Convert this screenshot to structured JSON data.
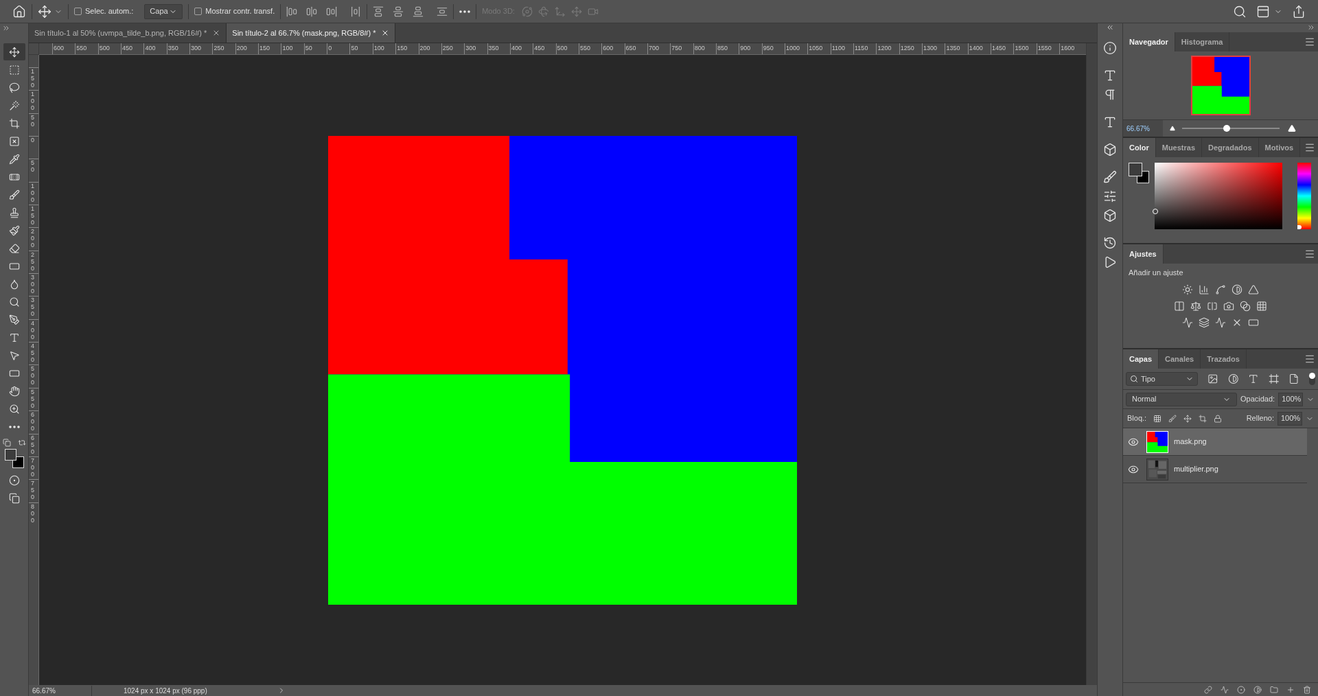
{
  "options_bar": {
    "auto_select": {
      "label": "Selec. autom.:",
      "checked": false
    },
    "target": "Capa",
    "show_transform": {
      "label": "Mostrar contr. transf.",
      "checked": false
    },
    "mode_3d": {
      "label": "Modo 3D:",
      "disabled": true
    }
  },
  "document_tabs": [
    {
      "title": "Sin título-1 al 50% (uvmpa_tilde_b.png, RGB/16#) *",
      "selected": false
    },
    {
      "title": "Sin título-2 al 66.7% (mask.png, RGB/8#) *",
      "selected": true
    }
  ],
  "tools": [
    {
      "selected": true
    },
    {
      "selected": false
    },
    {
      "selected": false
    },
    {
      "selected": false
    },
    {
      "selected": false
    },
    {
      "selected": false
    },
    {
      "selected": false
    },
    {
      "selected": false
    },
    {
      "selected": false
    },
    {
      "selected": false
    },
    {
      "selected": false
    },
    {
      "selected": false
    },
    {
      "selected": false
    },
    {
      "selected": false
    },
    {
      "selected": false
    },
    {
      "selected": false
    },
    {
      "selected": false
    },
    {
      "selected": false
    },
    {
      "selected": false
    },
    {
      "selected": false
    },
    {
      "selected": false
    },
    {
      "selected": false
    }
  ],
  "ruler_h": [
    "600",
    "550",
    "500",
    "450",
    "400",
    "350",
    "300",
    "250",
    "200",
    "150",
    "100",
    "50",
    "0",
    "50",
    "100",
    "150",
    "200",
    "250",
    "300",
    "350",
    "400",
    "450",
    "500",
    "550",
    "600",
    "650",
    "700",
    "750",
    "800",
    "850",
    "900",
    "950",
    "1000",
    "1050",
    "1100",
    "1150",
    "1200",
    "1250",
    "1300",
    "1350",
    "1400",
    "1450",
    "1500",
    "1550",
    "1600"
  ],
  "ruler_v": [
    "150",
    "100",
    "50",
    "0",
    "50",
    "100",
    "150",
    "200",
    "250",
    "300",
    "350",
    "400",
    "450",
    "500",
    "550",
    "600",
    "650",
    "700",
    "750",
    "800"
  ],
  "navigator": {
    "tabs": [
      {
        "label": "Navegador",
        "selected": true
      },
      {
        "label": "Histograma",
        "selected": false
      }
    ],
    "zoom": "66.67%",
    "level": 0.46
  },
  "color_panel": {
    "hue": {
      "level": 0
    },
    "tabs": [
      {
        "label": "Color",
        "selected": true
      },
      {
        "label": "Muestras",
        "selected": false
      },
      {
        "label": "Degradados",
        "selected": false
      },
      {
        "label": "Motivos",
        "selected": false
      }
    ]
  },
  "adjustments": {
    "tabs": [
      {
        "label": "Ajustes",
        "selected": true
      }
    ],
    "hint": "Añadir un ajuste"
  },
  "layers_panel": {
    "tabs": [
      {
        "label": "Capas",
        "selected": true
      },
      {
        "label": "Canales",
        "selected": false
      },
      {
        "label": "Trazados",
        "selected": false
      }
    ],
    "filter": "Tipo",
    "filter_on": true,
    "blend_mode": "Normal",
    "opacity_label": "Opacidad:",
    "opacity": "100%",
    "lock_label": "Bloq.:",
    "fill_label": "Relleno:",
    "fill": "100%",
    "layers": [
      {
        "name": "mask.png",
        "visible": true,
        "selected": true,
        "kind": "mask"
      },
      {
        "name": "multiplier.png",
        "visible": true,
        "selected": false,
        "kind": "texture"
      }
    ]
  },
  "status_bar": {
    "zoom": "66.67%",
    "info": "1024 px x 1024 px (96 ppp)"
  }
}
